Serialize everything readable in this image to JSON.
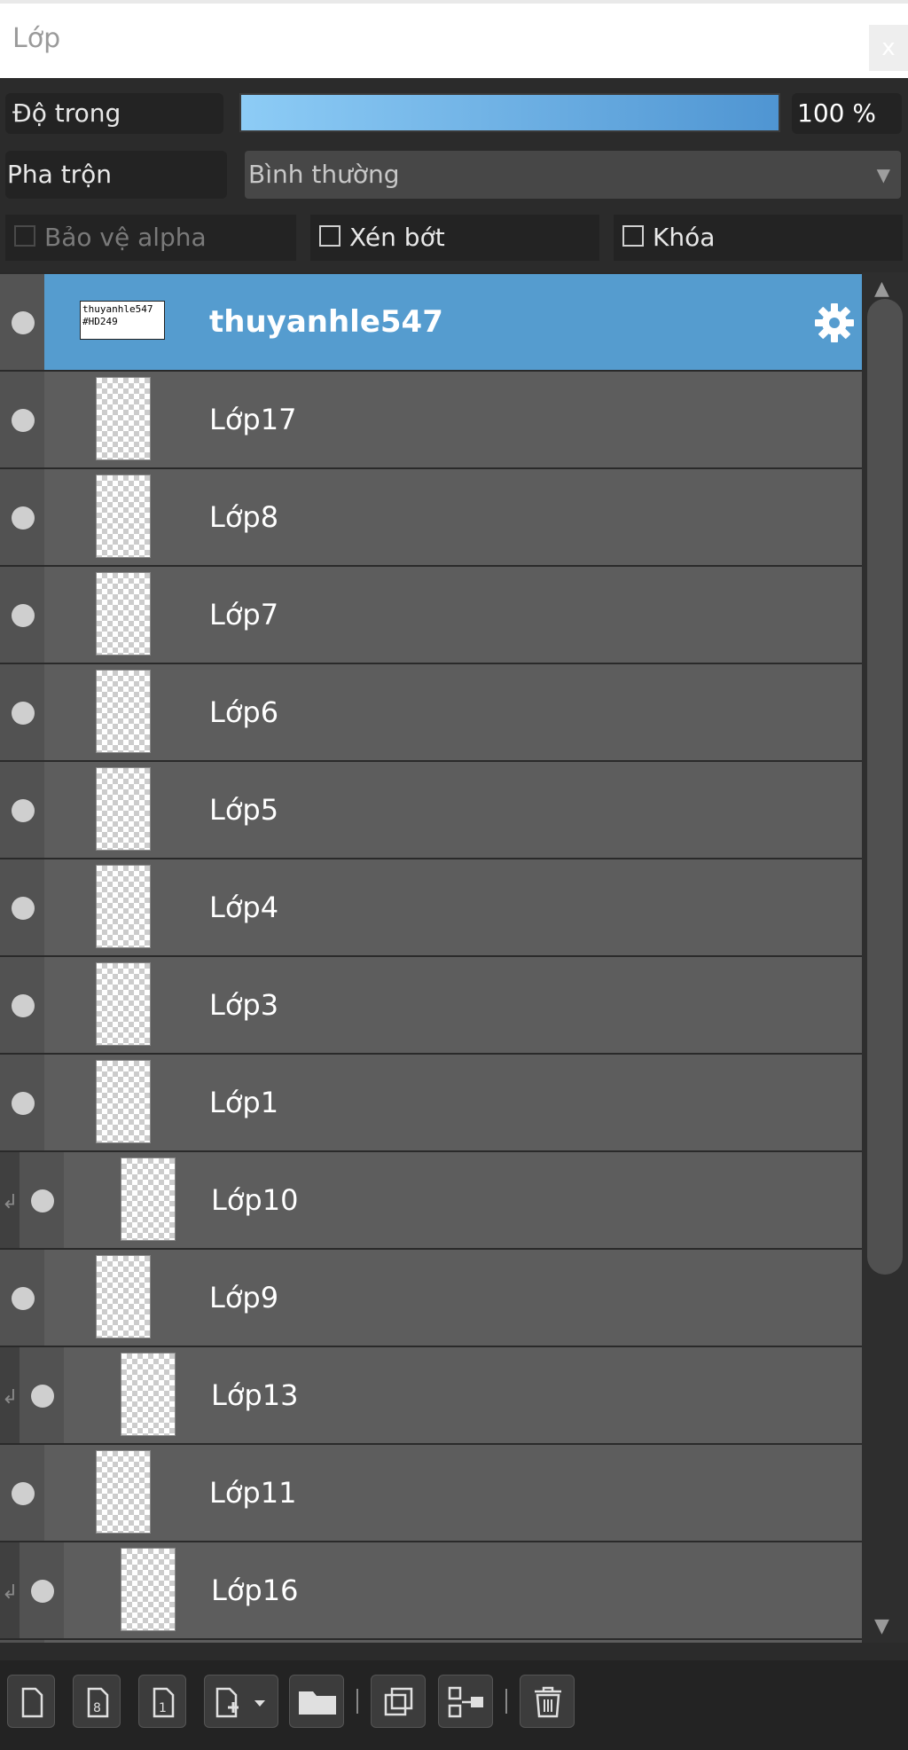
{
  "panel": {
    "title": "Lớp",
    "close_label": "x"
  },
  "properties": {
    "opacity_label": "Độ trong",
    "opacity_value_text": "100 %",
    "opacity_fraction": 1.0,
    "blend_label": "Pha trộn",
    "blend_value": "Bình thường",
    "protect_alpha_label": "Bảo vệ alpha",
    "clipping_label": "Xén bớt",
    "lock_label": "Khóa"
  },
  "layers": [
    {
      "name": "thuyanhle547",
      "selected": true,
      "clipped": false,
      "thumb_text": "thuyanhle547 #HD249"
    },
    {
      "name": "Lớp17",
      "selected": false,
      "clipped": false
    },
    {
      "name": "Lớp8",
      "selected": false,
      "clipped": false
    },
    {
      "name": "Lớp7",
      "selected": false,
      "clipped": false
    },
    {
      "name": "Lớp6",
      "selected": false,
      "clipped": false
    },
    {
      "name": "Lớp5",
      "selected": false,
      "clipped": false
    },
    {
      "name": "Lớp4",
      "selected": false,
      "clipped": false
    },
    {
      "name": "Lớp3",
      "selected": false,
      "clipped": false
    },
    {
      "name": "Lớp1",
      "selected": false,
      "clipped": false
    },
    {
      "name": "Lớp10",
      "selected": false,
      "clipped": true
    },
    {
      "name": "Lớp9",
      "selected": false,
      "clipped": false
    },
    {
      "name": "Lớp13",
      "selected": false,
      "clipped": true
    },
    {
      "name": "Lớp11",
      "selected": false,
      "clipped": false
    },
    {
      "name": "Lớp16",
      "selected": false,
      "clipped": true
    }
  ],
  "toolbar_icons": [
    "new-layer-icon",
    "new-8bit-layer-icon",
    "new-1bit-layer-icon",
    "add-layer-menu-icon",
    "new-folder-icon",
    "duplicate-layer-icon",
    "merge-down-icon",
    "delete-layer-icon"
  ],
  "colors": {
    "selected_row": "#559ccf",
    "opacity_fill_start": "#8dccf6",
    "opacity_fill_end": "#4f95d2"
  }
}
